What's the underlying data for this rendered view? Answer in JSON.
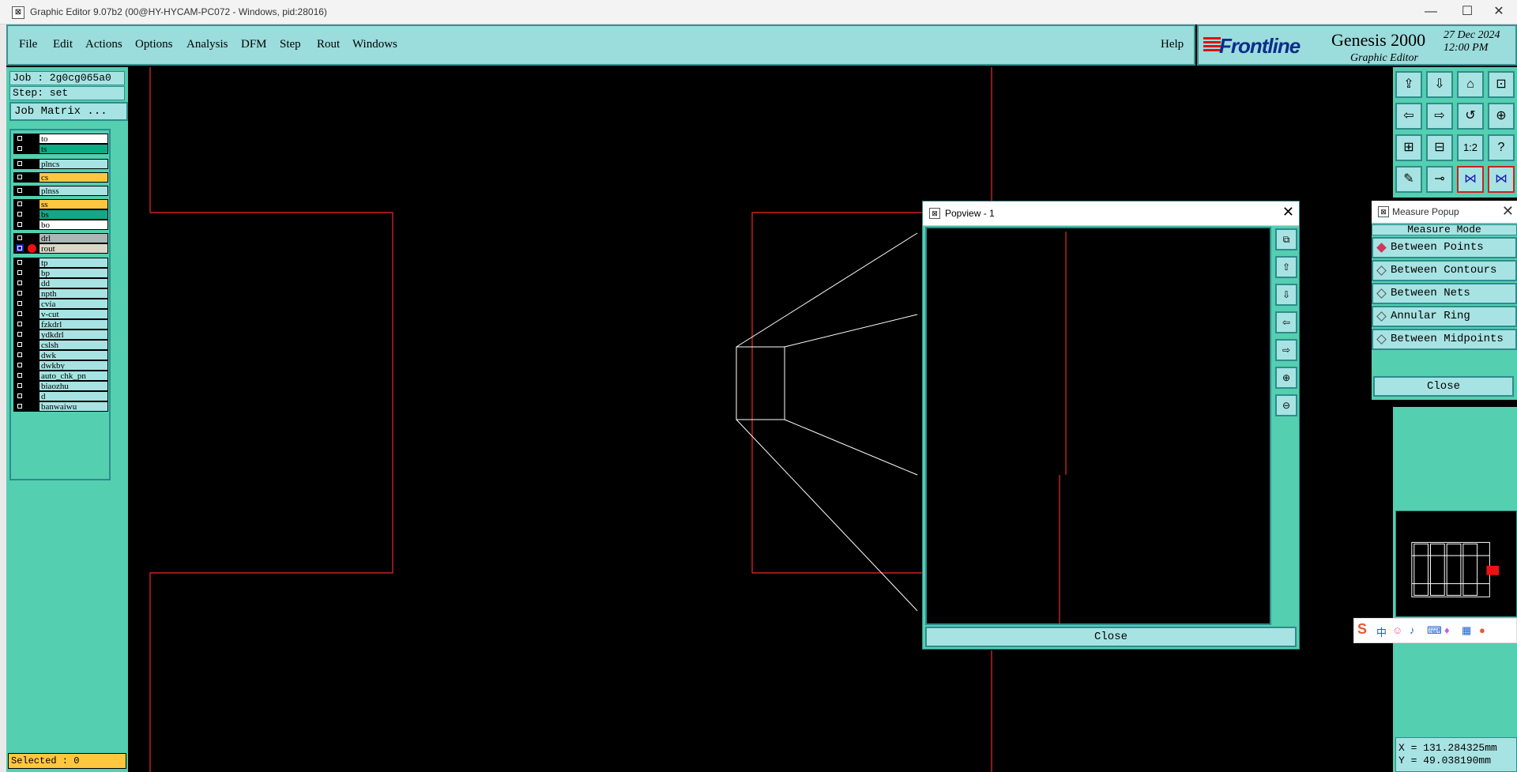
{
  "window": {
    "title": "Graphic Editor 9.07b2 (00@HY-HYCAM-PC072 - Windows, pid:28016)"
  },
  "menu": {
    "items": [
      "File",
      "Edit",
      "Actions",
      "Options",
      "Analysis",
      "DFM",
      "Step",
      "Rout",
      "Windows"
    ],
    "help": "Help"
  },
  "brand": {
    "logo": "Frontline",
    "product": "Genesis 2000",
    "subtitle": "Graphic Editor",
    "date": "27 Dec 2024",
    "time": "12:00 PM"
  },
  "job": {
    "job_label": "Job : 2g0cg065a0",
    "step_label": "Step: set",
    "matrix_button": "Job Matrix ..."
  },
  "layers": [
    {
      "name": "to",
      "color": "#ffffff",
      "active": false
    },
    {
      "name": "ts",
      "color": "#11a884",
      "active": false
    },
    {
      "name": "plncs",
      "color": "#a8e3e3",
      "active": false
    },
    {
      "name": "cs",
      "color": "#ffc640",
      "active": false
    },
    {
      "name": "plnss",
      "color": "#a8e3e3",
      "active": false
    },
    {
      "name": "ss",
      "color": "#ffc640",
      "active": false
    },
    {
      "name": "bs",
      "color": "#11a884",
      "active": false
    },
    {
      "name": "bo",
      "color": "#ffffff",
      "active": false
    },
    {
      "name": "drl",
      "color": "#a9b7b7",
      "active": false
    },
    {
      "name": "rout",
      "color": "#d8d8c8",
      "active": true
    },
    {
      "name": "tp",
      "color": "#a8e3e3",
      "active": false
    },
    {
      "name": "bp",
      "color": "#a8e3e3",
      "active": false
    },
    {
      "name": "dd",
      "color": "#a8e3e3",
      "active": false
    },
    {
      "name": "npth",
      "color": "#a8e3e3",
      "active": false
    },
    {
      "name": "cvia",
      "color": "#a8e3e3",
      "active": false
    },
    {
      "name": "v-cut",
      "color": "#a8e3e3",
      "active": false
    },
    {
      "name": "fzkdrl",
      "color": "#a8e3e3",
      "active": false
    },
    {
      "name": "ydkdrl",
      "color": "#a8e3e3",
      "active": false
    },
    {
      "name": "cslsh",
      "color": "#a8e3e3",
      "active": false
    },
    {
      "name": "dwk",
      "color": "#a8e3e3",
      "active": false
    },
    {
      "name": "dwkby",
      "color": "#a8e3e3",
      "active": false
    },
    {
      "name": "auto_chk_pn",
      "color": "#a8e3e3",
      "active": false
    },
    {
      "name": "biaozhu",
      "color": "#a8e3e3",
      "active": false
    },
    {
      "name": "d",
      "color": "#a8e3e3",
      "active": false
    },
    {
      "name": "banwaiwu",
      "color": "#a8e3e3",
      "active": false
    }
  ],
  "status": {
    "selected": "Selected : 0"
  },
  "popview": {
    "title": "Popview - 1",
    "close": "Close"
  },
  "measure": {
    "title": "Measure Popup",
    "mode_label": "Measure Mode",
    "options": [
      {
        "label": "Between Points",
        "selected": true
      },
      {
        "label": "Between Contours",
        "selected": false
      },
      {
        "label": "Between Nets",
        "selected": false
      },
      {
        "label": "Annular Ring",
        "selected": false
      },
      {
        "label": "Between Midpoints",
        "selected": false
      }
    ],
    "close": "Close"
  },
  "toolbar": {
    "icons": [
      "zoom-home-icon",
      "zoom-fit-icon",
      "snap-icon",
      "window-icon",
      "pan-left-icon",
      "pan-right-icon",
      "redraw-icon",
      "zoom-in-icon",
      "zoom-area-icon",
      "zoom-window-icon",
      "scale-1-2-icon",
      "help-icon",
      "snap-tool-icon",
      "cursor-icon",
      "net-icon",
      "net-highlight-icon"
    ],
    "scale_label": "1:2",
    "help_label": "?"
  },
  "coords": {
    "x": "X = 131.284325mm",
    "y": "Y = 49.038190mm"
  },
  "ime": {
    "lang": "中"
  },
  "colors": {
    "panel": "#54cfb0",
    "button": "#a8e3e3",
    "menu": "#9bdcdc",
    "outline": "#cc2222",
    "accent_selected": "#ffc640"
  }
}
